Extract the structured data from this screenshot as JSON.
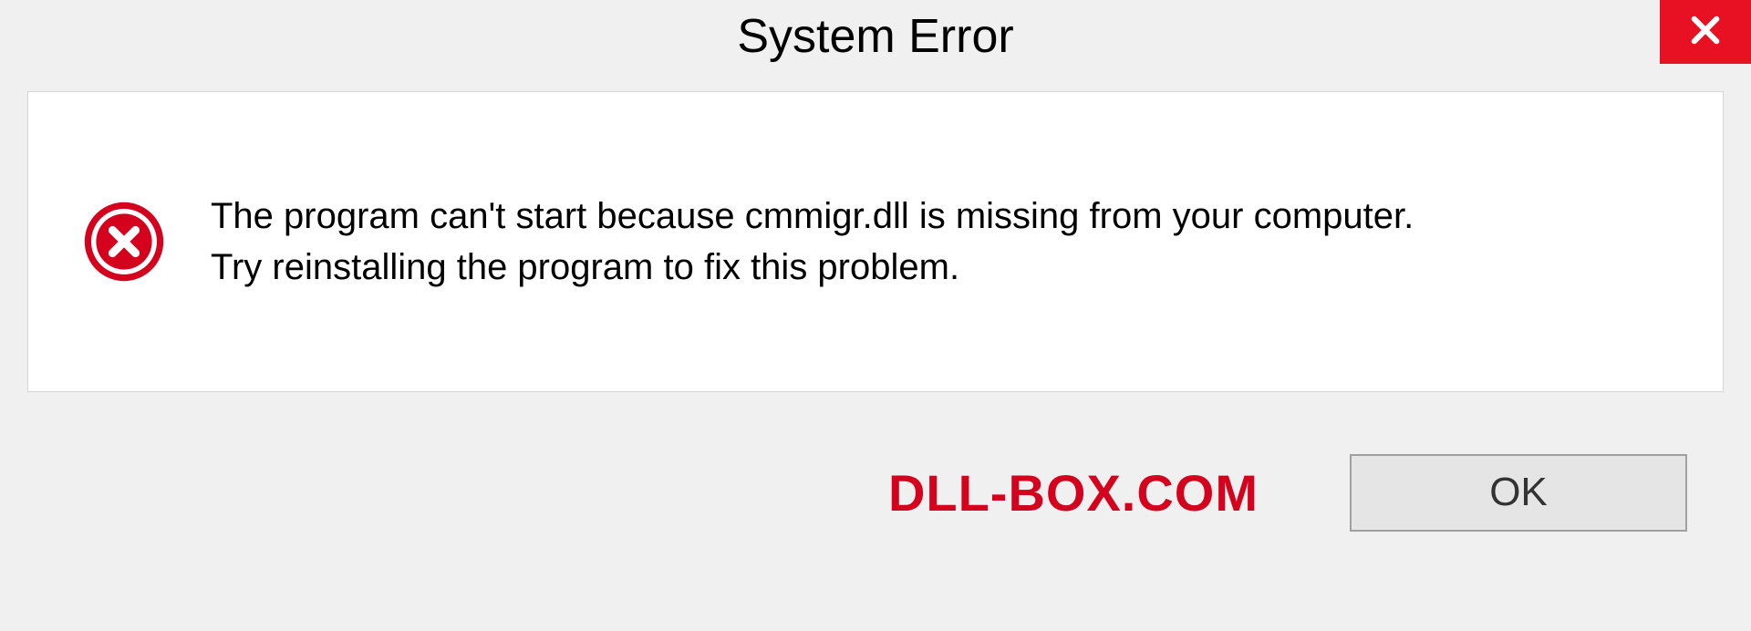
{
  "dialog": {
    "title": "System Error",
    "message_line1": "The program can't start because cmmigr.dll is missing from your computer.",
    "message_line2": "Try reinstalling the program to fix this problem.",
    "ok_label": "OK",
    "watermark": "DLL-BOX.COM",
    "colors": {
      "close_button_bg": "#e81123",
      "error_icon": "#d4021d",
      "watermark": "#d4021d",
      "window_bg": "#f0f0f0",
      "content_bg": "#ffffff"
    },
    "icons": {
      "close": "close-icon",
      "error": "error-circle-x-icon"
    }
  }
}
